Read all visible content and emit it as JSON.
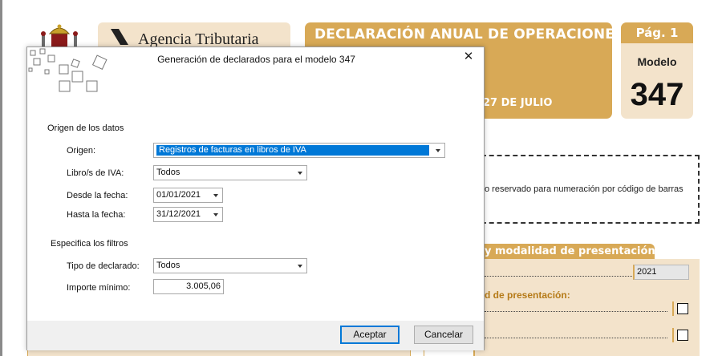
{
  "form": {
    "agency_name": "Agencia Tributaria",
    "title_line1": "DECLARACIÓN ANUAL DE OPERACIONES",
    "title_line3": "27 DE JULIO",
    "page_label": "Pág. 1",
    "modelo_label": "Modelo",
    "modelo_number": "347",
    "barcode_text": "o reservado para numeración por código de barras",
    "section_tab": "y modalidad de presentación",
    "year_value": "2021",
    "modalidad_label": "d de presentación:"
  },
  "dialog": {
    "title": "Generación de declarados para el modelo 347",
    "close_glyph": "✕",
    "origen_section": "Origen de los datos",
    "origen_label": "Origen:",
    "origen_value": "Registros de facturas en libros de IVA",
    "libros_label": "Libro/s de IVA:",
    "libros_value": "Todos",
    "desde_label": "Desde la fecha:",
    "desde_value": "01/01/2021",
    "hasta_label": "Hasta la fecha:",
    "hasta_value": "31/12/2021",
    "filtros_section": "Especifica los filtros",
    "tipo_label": "Tipo de declarado:",
    "tipo_value": "Todos",
    "importe_label": "Importe mínimo:",
    "importe_value": "3.005,06",
    "accept_label": "Aceptar",
    "cancel_label": "Cancelar"
  },
  "colors": {
    "accent_gold": "#d8a956",
    "light_beige": "#f3e3cb",
    "selection_blue": "#0078d7"
  },
  "icons": [
    "coat-of-arms-icon",
    "agency-logo-icon",
    "decorative-squares-icon",
    "close-icon",
    "dropdown-arrow-icon"
  ]
}
